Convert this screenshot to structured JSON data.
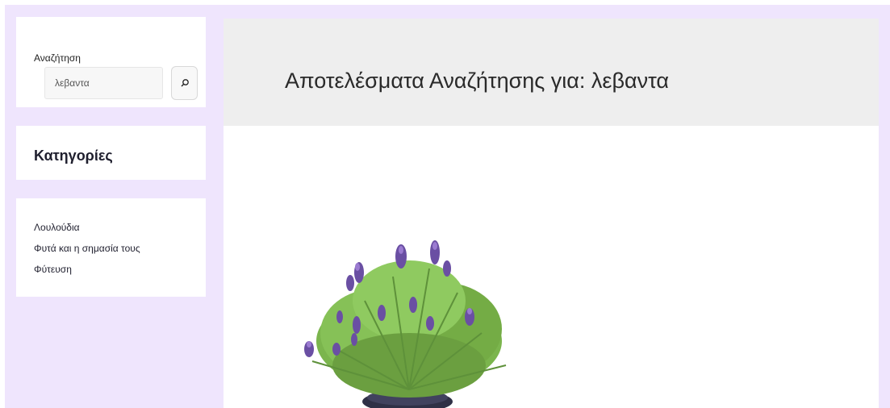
{
  "sidebar": {
    "search": {
      "label": "Αναζήτηση",
      "value": "λεβαντα",
      "button_icon": "search-icon"
    },
    "categories_title": "Κατηγορίες",
    "links": [
      "Λουλούδια",
      "Φυτά και η σημασία τους",
      "Φύτευση"
    ]
  },
  "main": {
    "title": "Αποτελέσματα Αναζήτησης για: λεβαντα",
    "image": "lavender-plant"
  },
  "colors": {
    "page_bg": "#efe5fd",
    "header_bg": "#eeeeee",
    "lavender": "#6f55a8",
    "foliage": "#6fa84a"
  }
}
